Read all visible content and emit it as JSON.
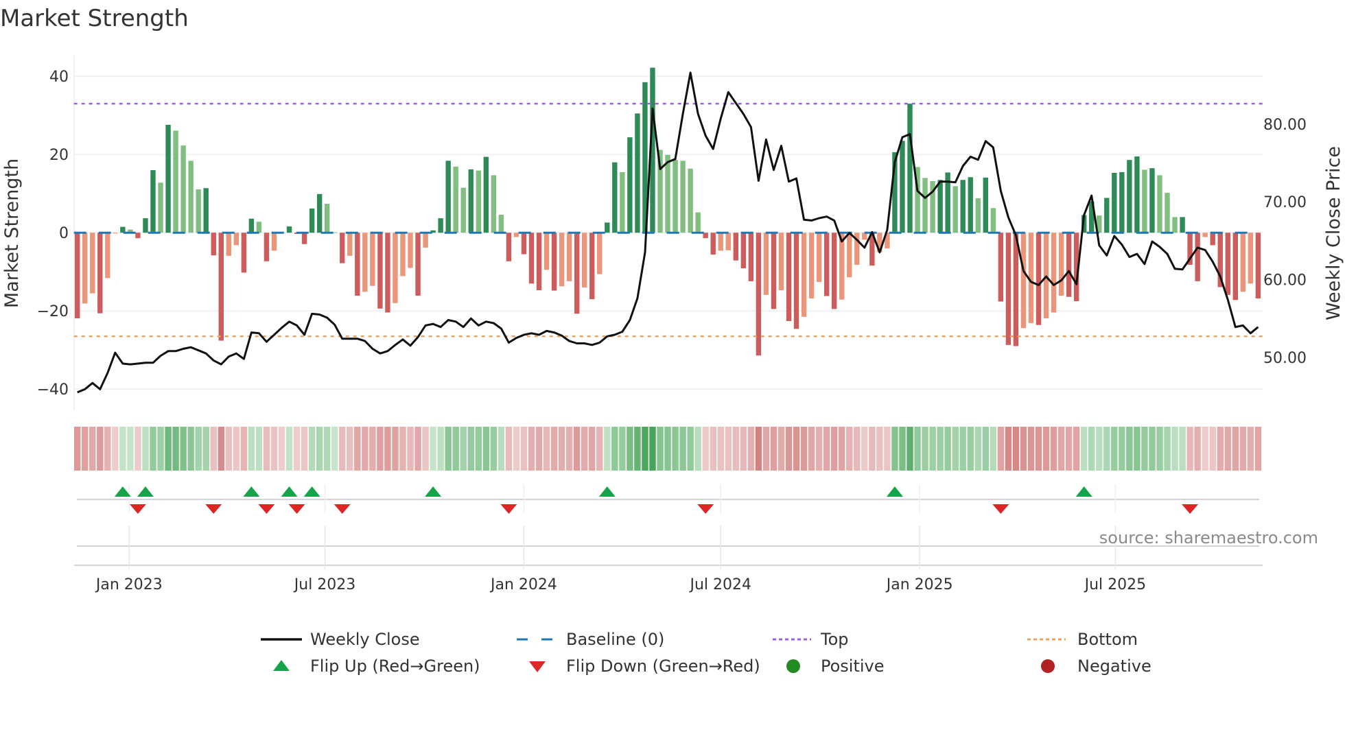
{
  "title": "Market Strength",
  "source": "source: sharemaestro.com",
  "chart_data": {
    "type": "bar",
    "title": "Market Strength",
    "frequency": "weekly",
    "start_week": "2022-11-14",
    "ylabel": "Market Strength",
    "ylabel_right": "Weekly Close Price",
    "ylim": [
      -45.4,
      45.3
    ],
    "ylim_right": [
      43.2,
      88.8
    ],
    "yticks": [
      {
        "v": 40,
        "label": "40"
      },
      {
        "v": 20,
        "label": "20"
      },
      {
        "v": 0,
        "label": "0"
      },
      {
        "v": -20,
        "label": "−20"
      },
      {
        "v": -40,
        "label": "−40"
      }
    ],
    "yticks_right": [
      {
        "v": 80,
        "label": "80.00"
      },
      {
        "v": 70,
        "label": "70.00"
      },
      {
        "v": 60,
        "label": "60.00"
      },
      {
        "v": 50,
        "label": "50.00"
      }
    ],
    "xticks": [
      {
        "date": "2023-01-01",
        "label": "Jan 2023"
      },
      {
        "date": "2023-07-01",
        "label": "Jul 2023"
      },
      {
        "date": "2024-01-01",
        "label": "Jan 2024"
      },
      {
        "date": "2024-07-01",
        "label": "Jul 2024"
      },
      {
        "date": "2025-01-01",
        "label": "Jan 2025"
      },
      {
        "date": "2025-07-01",
        "label": "Jul 2025"
      }
    ],
    "grid": true,
    "baseline": 0,
    "top_level": 33,
    "bottom_level": -26.5,
    "series": [
      {
        "name": "Market Strength",
        "type": "bar",
        "values": [
          -21.9,
          -18.1,
          -15.5,
          -20.6,
          -11.6,
          -0.2,
          1.5,
          0.8,
          -1.4,
          3.7,
          16.0,
          12.8,
          27.6,
          26.1,
          22.3,
          18.4,
          11.1,
          11.4,
          -5.8,
          -27.6,
          -5.9,
          -3.2,
          -10.2,
          3.6,
          2.8,
          -7.3,
          -4.6,
          -0.1,
          1.6,
          -0.3,
          -2.9,
          6.2,
          9.9,
          7.4,
          0.1,
          -7.8,
          -5.9,
          -16.1,
          -15.1,
          -13.6,
          -19.4,
          -20.4,
          -18.0,
          -11.1,
          -9.0,
          -16.1,
          -3.8,
          0.6,
          3.7,
          18.4,
          16.9,
          11.5,
          16.2,
          15.9,
          19.4,
          14.7,
          4.6,
          -7.3,
          -1.1,
          -5.5,
          -13.0,
          -14.7,
          -9.5,
          -14.8,
          -13.7,
          -12.4,
          -20.7,
          -14.0,
          -17.0,
          -10.6,
          2.6,
          18.0,
          15.5,
          24.4,
          30.5,
          38.5,
          42.2,
          21.2,
          19.9,
          18.6,
          18.4,
          16.4,
          5.2,
          -1.4,
          -5.6,
          -4.6,
          -4.5,
          -7.1,
          -9.1,
          -12.4,
          -31.4,
          -15.9,
          -19.5,
          -14.7,
          -22.6,
          -24.6,
          -21.5,
          -16.8,
          -12.6,
          -16.2,
          -19.5,
          -17.1,
          -11.4,
          -8.2,
          -1.8,
          -8.4,
          -5.0,
          -4.0,
          20.6,
          23.5,
          33.0,
          16.8,
          14.0,
          13.2,
          13.5,
          15.4,
          11.9,
          13.5,
          14.2,
          8.8,
          14.1,
          6.3,
          -17.6,
          -28.7,
          -29.0,
          -24.4,
          -23.1,
          -23.6,
          -21.9,
          -20.4,
          -16.1,
          -16.4,
          -17.5,
          4.5,
          8.0,
          4.4,
          8.9,
          15.3,
          15.5,
          18.6,
          19.5,
          16.1,
          16.5,
          14.7,
          10.2,
          4.0,
          4.0,
          -8.2,
          -12.4,
          -1.1,
          -3.2,
          -13.9,
          -15.9,
          -17.2,
          -15.1,
          -13.0,
          -16.8
        ]
      },
      {
        "name": "Weekly Close",
        "type": "line",
        "axis": "right",
        "values": [
          45.5,
          45.9,
          46.7,
          45.9,
          48.0,
          50.6,
          49.2,
          49.1,
          49.2,
          49.3,
          49.3,
          50.2,
          50.8,
          50.8,
          51.1,
          51.3,
          50.9,
          50.5,
          49.6,
          49.1,
          50.1,
          50.5,
          49.8,
          53.2,
          53.1,
          52.0,
          52.9,
          53.8,
          54.6,
          54.1,
          52.9,
          55.6,
          55.5,
          55.1,
          54.2,
          52.4,
          52.4,
          52.4,
          52.1,
          51.1,
          50.5,
          50.8,
          51.6,
          52.3,
          51.5,
          52.6,
          54.1,
          54.3,
          53.9,
          54.8,
          54.6,
          53.9,
          55.0,
          54.1,
          54.6,
          54.4,
          53.7,
          51.9,
          52.5,
          52.9,
          53.1,
          52.9,
          53.4,
          53.2,
          52.8,
          52.1,
          51.8,
          51.8,
          51.6,
          51.9,
          52.7,
          52.9,
          53.3,
          54.8,
          57.6,
          63.5,
          82.0,
          74.2,
          75.1,
          75.5,
          81.3,
          86.6,
          81.3,
          78.5,
          76.8,
          80.7,
          84.1,
          82.7,
          81.3,
          79.6,
          72.7,
          78.0,
          74.1,
          77.2,
          72.6,
          73.0,
          67.7,
          67.6,
          67.9,
          68.1,
          67.6,
          64.9,
          66.0,
          65.1,
          64.1,
          66.1,
          63.5,
          66.4,
          75.1,
          78.3,
          78.7,
          71.4,
          70.5,
          71.3,
          72.6,
          72.6,
          72.5,
          74.6,
          75.8,
          75.4,
          77.8,
          77.0,
          71.4,
          68.0,
          65.7,
          61.1,
          59.7,
          59.3,
          60.4,
          59.3,
          59.9,
          61.1,
          59.4,
          68.3,
          70.8,
          64.4,
          63.1,
          65.6,
          64.5,
          62.9,
          63.3,
          62.0,
          64.9,
          64.2,
          63.3,
          61.4,
          61.3,
          62.7,
          64.1,
          63.8,
          62.3,
          60.4,
          57.4,
          53.9,
          54.1,
          53.1,
          53.9
        ]
      }
    ],
    "legend": {
      "placement": "bottom",
      "items": [
        {
          "label": "Weekly Close",
          "kind": "line"
        },
        {
          "label": "Baseline (0)",
          "kind": "dash"
        },
        {
          "label": "Top",
          "kind": "dot-top"
        },
        {
          "label": "Bottom",
          "kind": "dot-bottom"
        },
        {
          "label": "Flip Up (Red→Green)",
          "kind": "tri-up"
        },
        {
          "label": "Flip Down (Green→Red)",
          "kind": "tri-down"
        },
        {
          "label": "Positive",
          "kind": "circle-pos"
        },
        {
          "label": "Negative",
          "kind": "circle-neg"
        }
      ]
    }
  },
  "colors": {
    "pos_dark": "#2e8b57",
    "pos_light": "#80bf80",
    "neg_dark": "#cd5c5c",
    "neg_light": "#e9967a",
    "close": "#111111",
    "baseline": "#1f77b4",
    "top": "#9b5fe0",
    "bottom": "#f0a35e",
    "flip_up": "#17a34a",
    "flip_down": "#dc2626",
    "positive": "#228b22",
    "negative": "#b22222"
  }
}
